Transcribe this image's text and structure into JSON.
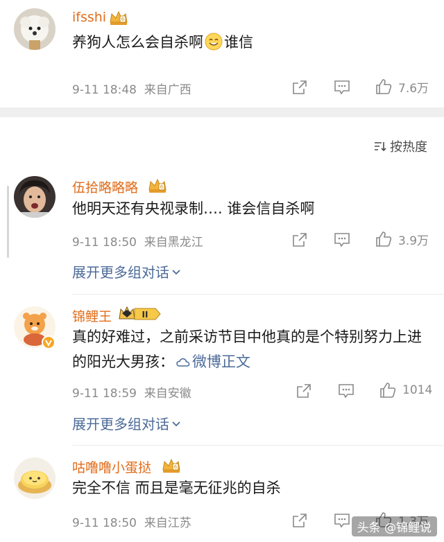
{
  "sort_label": "按热度",
  "comments": [
    {
      "name": "ifsshi",
      "text": "养狗人怎么会自杀啊",
      "text_tail": "谁信",
      "time": "9-11 18:48",
      "location": "来自广西",
      "likes": "7.6万"
    },
    {
      "name": "伍拾略略略",
      "text": "他明天还有央视录制…. 谁会信自杀啊",
      "time": "9-11 18:50",
      "location": "来自黑龙江",
      "likes": "3.9万",
      "expand": "展开更多组对话"
    },
    {
      "name": "锦鲤王",
      "badge_level": "II",
      "text": "真的好难过，之前采访节目中他真的是个特别努力上进的阳光大男孩：",
      "link": "微博正文",
      "time": "9-11 18:59",
      "location": "来自安徽",
      "likes": "1014",
      "expand": "展开更多组对话"
    },
    {
      "name": "咕噜噜小蛋挞",
      "text": "完全不信 而且是毫无征兆的自杀",
      "time": "9-11 18:50",
      "location": "来自江苏",
      "likes": "1.3万"
    }
  ],
  "watermark": "头条 @锦鲤说",
  "colors": {
    "username": "#e06c1a",
    "link": "#4b6a98",
    "meta": "#8a8a8a"
  }
}
